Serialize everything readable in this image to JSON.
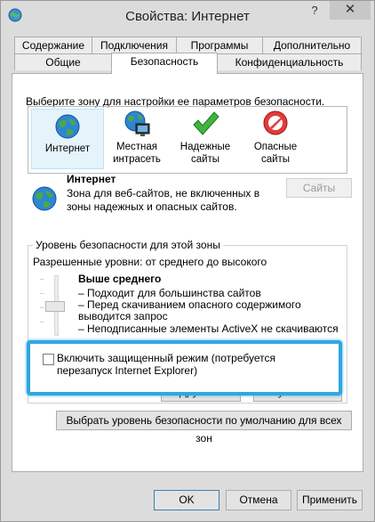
{
  "window": {
    "title": "Свойства: Интернет"
  },
  "title_buttons": {
    "help": "?",
    "close": "✕"
  },
  "tabs_top": [
    "Содержание",
    "Подключения",
    "Программы",
    "Дополнительно"
  ],
  "tabs_bottom": [
    "Общие",
    "Безопасность",
    "Конфиденциальность"
  ],
  "active_tab": "Безопасность",
  "zones_prompt": "Выберите зону для настройки ее параметров безопасности.",
  "zones": [
    {
      "label": "Интернет",
      "icon": "globe-icon",
      "selected": true
    },
    {
      "label": "Местная интрасеть",
      "icon": "intranet-icon",
      "selected": false
    },
    {
      "label": "Надежные сайты",
      "icon": "checkmark-icon",
      "selected": false
    },
    {
      "label": "Опасные сайты",
      "icon": "forbidden-icon",
      "selected": false
    }
  ],
  "zone_info": {
    "title": "Интернет",
    "description": "Зона для веб-сайтов, не включенных в зоны надежных и опасных сайтов.",
    "sites_button": "Сайты"
  },
  "security_level": {
    "group_title": "Уровень безопасности для этой зоны",
    "allowed_levels": "Разрешенные уровни: от среднего до высокого",
    "level_name": "Выше среднего",
    "bullets": [
      "– Подходит для большинства сайтов",
      "– Перед скачиванием опасного содержимого выводится запрос",
      "– Неподписанные элементы ActiveX не скачиваются"
    ],
    "protected_mode_label": "Включить защищенный режим (потребуется перезапуск Internet Explorer)",
    "protected_mode_checked": false,
    "custom_button": "Другой...",
    "default_button": "По умолчанию"
  },
  "reset_all_button": "Выбрать уровень безопасности по умолчанию для всех зон",
  "footer": {
    "ok": "OK",
    "cancel": "Отмена",
    "apply": "Применить"
  },
  "colors": {
    "highlight": "#2fa8e0",
    "window_bg": "#dcdcdc",
    "panel_bg": "#ffffff",
    "selected_zone_bg": "#e5f3fb"
  }
}
